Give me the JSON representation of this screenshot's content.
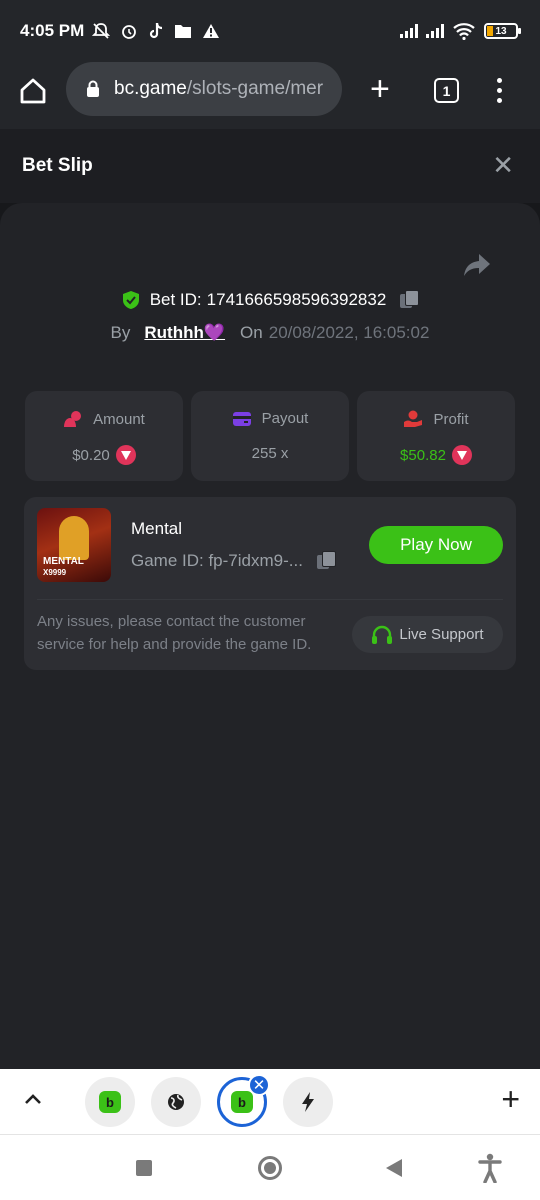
{
  "status_bar": {
    "time": "4:05 PM",
    "battery": "13"
  },
  "browser": {
    "url_domain": "bc.game",
    "url_path": "/slots-game/mer",
    "tab_count": "1"
  },
  "bet_slip": {
    "title": "Bet Slip",
    "bet_id_label": "Bet ID:",
    "bet_id": "1741666598596392832",
    "by_label": "By",
    "username": "Ruthhh💜",
    "on_label": "On",
    "date": "20/08/2022, 16:05:02",
    "stats": {
      "amount_label": "Amount",
      "amount_value": "$0.20",
      "payout_label": "Payout",
      "payout_value": "255 x",
      "profit_label": "Profit",
      "profit_value": "$50.82"
    },
    "colors": {
      "accent_green": "#3bc117",
      "amount_icon": "#e0345a",
      "payout_icon": "#7b3fe4",
      "profit_icon": "#e03a3a"
    }
  },
  "game": {
    "name": "Mental",
    "thumb_title": "MENTAL",
    "thumb_subtitle": "X9999",
    "game_id": "Game ID: fp-7idxm9-...",
    "play_label": "Play Now",
    "issue_text": "Any issues, please contact the customer service for help and provide the game ID.",
    "support_label": "Live Support"
  },
  "tabstrip": {
    "tabs": [
      {
        "icon": "bc-game-icon",
        "active": false
      },
      {
        "icon": "globe-icon",
        "active": false
      },
      {
        "icon": "bc-game-icon",
        "active": true
      },
      {
        "icon": "bolt-icon",
        "active": false
      }
    ]
  }
}
